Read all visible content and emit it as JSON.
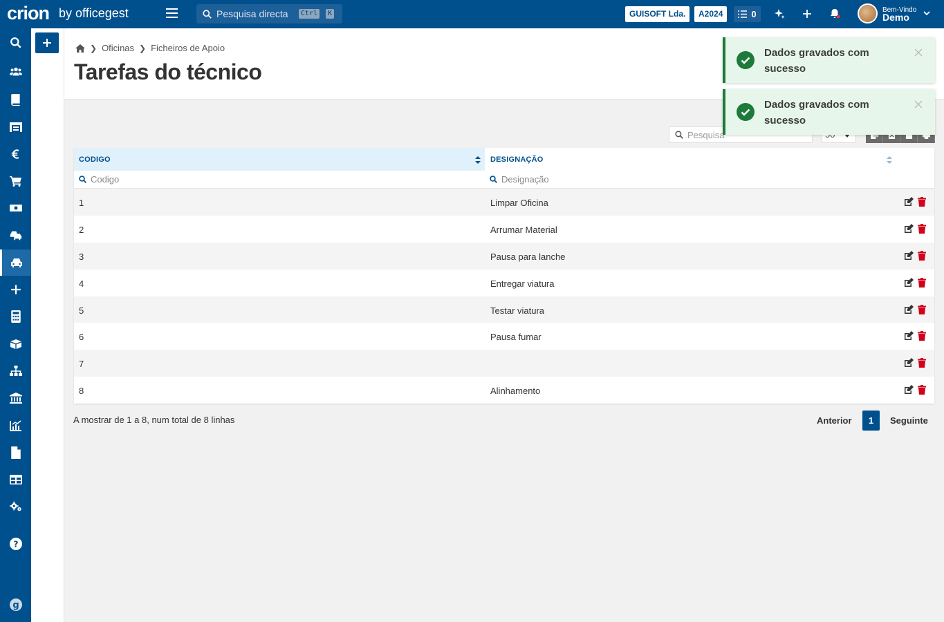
{
  "topbar": {
    "logo": "crion",
    "logo_by": "by officegest",
    "search_placeholder": "Pesquisa directa",
    "kbd_ctrl": "Ctrl",
    "kbd_k": "K",
    "company": "GUISOFT Lda.",
    "year": "A2024",
    "tasks_count": "0",
    "user_greeting": "Bem-Vindo",
    "user_name": "Demo"
  },
  "sidebar": {
    "items": [
      {
        "icon": "search-icon"
      },
      {
        "icon": "users-icon"
      },
      {
        "icon": "book-icon"
      },
      {
        "icon": "warehouse-icon"
      },
      {
        "icon": "euro-icon"
      },
      {
        "icon": "cart-icon"
      },
      {
        "icon": "money-icon"
      },
      {
        "icon": "cars-icon"
      },
      {
        "icon": "car-icon",
        "active": true
      },
      {
        "icon": "plus-icon"
      },
      {
        "icon": "calculator-icon"
      },
      {
        "icon": "box-icon"
      },
      {
        "icon": "sitemap-icon"
      },
      {
        "icon": "bank-icon"
      },
      {
        "icon": "chart-icon"
      },
      {
        "icon": "file-icon"
      },
      {
        "icon": "table-icon"
      },
      {
        "icon": "cogs-icon"
      },
      {
        "icon": "help-icon"
      },
      {
        "icon": "officegest-icon"
      }
    ]
  },
  "breadcrumb": {
    "items": [
      "Oficinas",
      "Ficheiros de Apoio"
    ]
  },
  "page": {
    "title": "Tarefas do técnico"
  },
  "toolbar": {
    "search_placeholder": "Pesquisa",
    "page_size": "50"
  },
  "table": {
    "columns": [
      "CODIGO",
      "DESIGNAÇÃO"
    ],
    "filters": [
      "Codigo",
      "Designação"
    ],
    "rows": [
      {
        "code": "1",
        "desc": "Limpar Oficina"
      },
      {
        "code": "2",
        "desc": "Arrumar Material"
      },
      {
        "code": "3",
        "desc": "Pausa para lanche"
      },
      {
        "code": "4",
        "desc": "Entregar viatura"
      },
      {
        "code": "5",
        "desc": "Testar viatura"
      },
      {
        "code": "6",
        "desc": "Pausa fumar"
      },
      {
        "code": "7",
        "desc": ""
      },
      {
        "code": "8",
        "desc": "Alinhamento"
      }
    ]
  },
  "footer": {
    "info": "A mostrar de 1 a 8, num total de 8 linhas",
    "prev": "Anterior",
    "current_page": "1",
    "next": "Seguinte"
  },
  "toasts": [
    {
      "message": "Dados gravados com sucesso"
    },
    {
      "message": "Dados gravados com sucesso"
    }
  ],
  "colors": {
    "primary": "#00508d",
    "success": "#1e7a3a",
    "danger": "#d0021b",
    "toast_bg": "#e7f6ea"
  }
}
